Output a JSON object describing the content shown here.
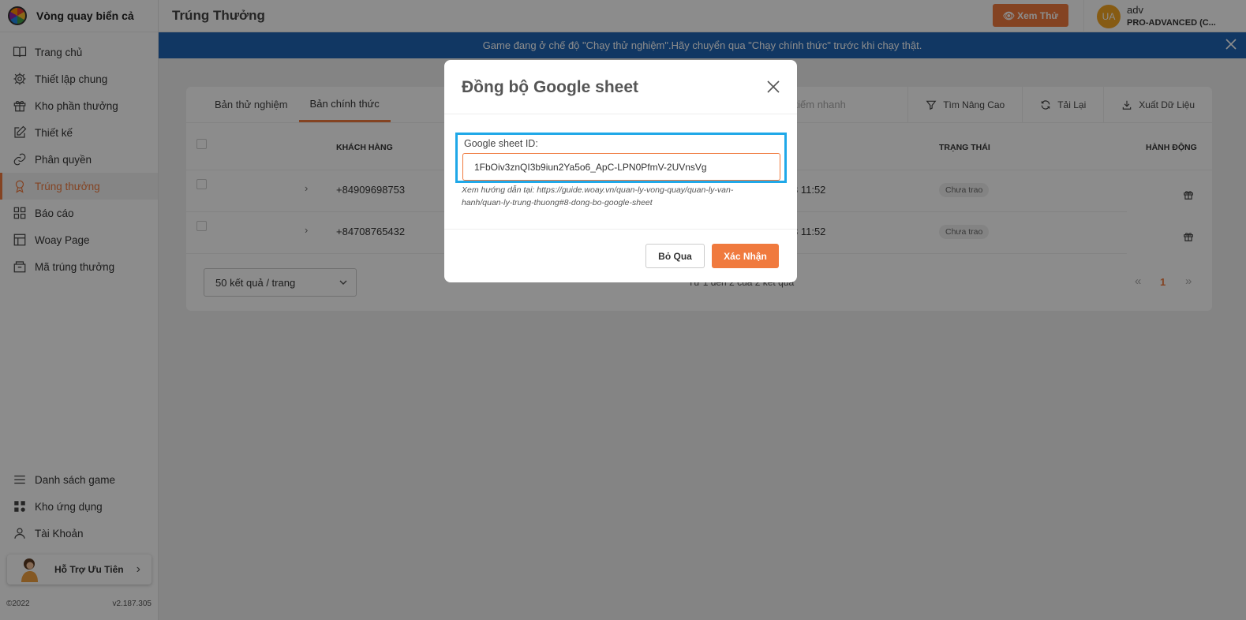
{
  "app": {
    "name": "Vòng quay biển cả"
  },
  "sidebar": {
    "items": [
      {
        "label": "Trang chủ",
        "icon": "book-open-icon"
      },
      {
        "label": "Thiết lập chung",
        "icon": "gear-icon"
      },
      {
        "label": "Kho phần thưởng",
        "icon": "gift-icon"
      },
      {
        "label": "Thiết kế",
        "icon": "edit-icon"
      },
      {
        "label": "Phân quyền",
        "icon": "link-icon"
      },
      {
        "label": "Trúng thưởng",
        "icon": "trophy-icon",
        "active": true
      },
      {
        "label": "Báo cáo",
        "icon": "grid-icon"
      },
      {
        "label": "Woay Page",
        "icon": "layout-icon"
      },
      {
        "label": "Mã trúng thưởng",
        "icon": "archive-icon"
      }
    ],
    "bottom_items": [
      {
        "label": "Danh sách game",
        "icon": "menu-icon"
      },
      {
        "label": "Kho ứng dụng",
        "icon": "apps-icon"
      },
      {
        "label": "Tài Khoản",
        "icon": "user-icon"
      }
    ],
    "support_label": "Hỗ Trợ Ưu Tiên",
    "copyright": "©2022",
    "version": "v2.187.305"
  },
  "header": {
    "title": "Trúng Thưởng",
    "preview_button": "Xem Thử",
    "user": {
      "initials": "UA",
      "name": "adv",
      "plan": "PRO-ADVANCED (C..."
    }
  },
  "banner": {
    "text": "Game đang ở chế độ \"Chạy thử nghiệm\".Hãy chuyển qua \"Chạy chính thức\" trước khi chạy thật."
  },
  "main": {
    "tabs": [
      {
        "label": "Bản thử nghiệm",
        "active": false
      },
      {
        "label": "Bản chính thức",
        "active": true
      }
    ],
    "search_placeholder": "m kiếm nhanh",
    "toolbar": {
      "advanced_search": "Tìm Nâng Cao",
      "reload": "Tải Lại",
      "export": "Xuất Dữ Liệu"
    },
    "table": {
      "headers": {
        "customer": "KHÁCH HÀNG",
        "status": "TRẠNG THÁI",
        "actions": "HÀNH ĐỘNG"
      },
      "rows": [
        {
          "phone": "+84909698753",
          "time": "3 11:52",
          "status": "Chưa trao"
        },
        {
          "phone": "+84708765432",
          "time": "3 11:52",
          "status": "Chưa trao"
        }
      ]
    },
    "pagination": {
      "page_size": "50 kết quả / trang",
      "range_text": "Từ 1 đến 2 của 2 kết quả",
      "prev": "«",
      "current_page": "1",
      "next": "»"
    }
  },
  "modal": {
    "title": "Đồng bộ Google sheet",
    "field_label": "Google sheet ID:",
    "field_value": "1FbOiv3znQI3b9iun2Ya5o6_ApC-LPN0PfmV-2UVnsVg",
    "hint": "Xem hướng dẫn tại: https://guide.woay.vn/quan-ly-vong-quay/quan-ly-van-hanh/quan-ly-trung-thuong#8-dong-bo-google-sheet",
    "cancel_label": "Bỏ Qua",
    "confirm_label": "Xác Nhận"
  },
  "colors": {
    "accent": "#f07a3e",
    "banner": "#1f65b4",
    "highlight": "#1fa8e8"
  }
}
